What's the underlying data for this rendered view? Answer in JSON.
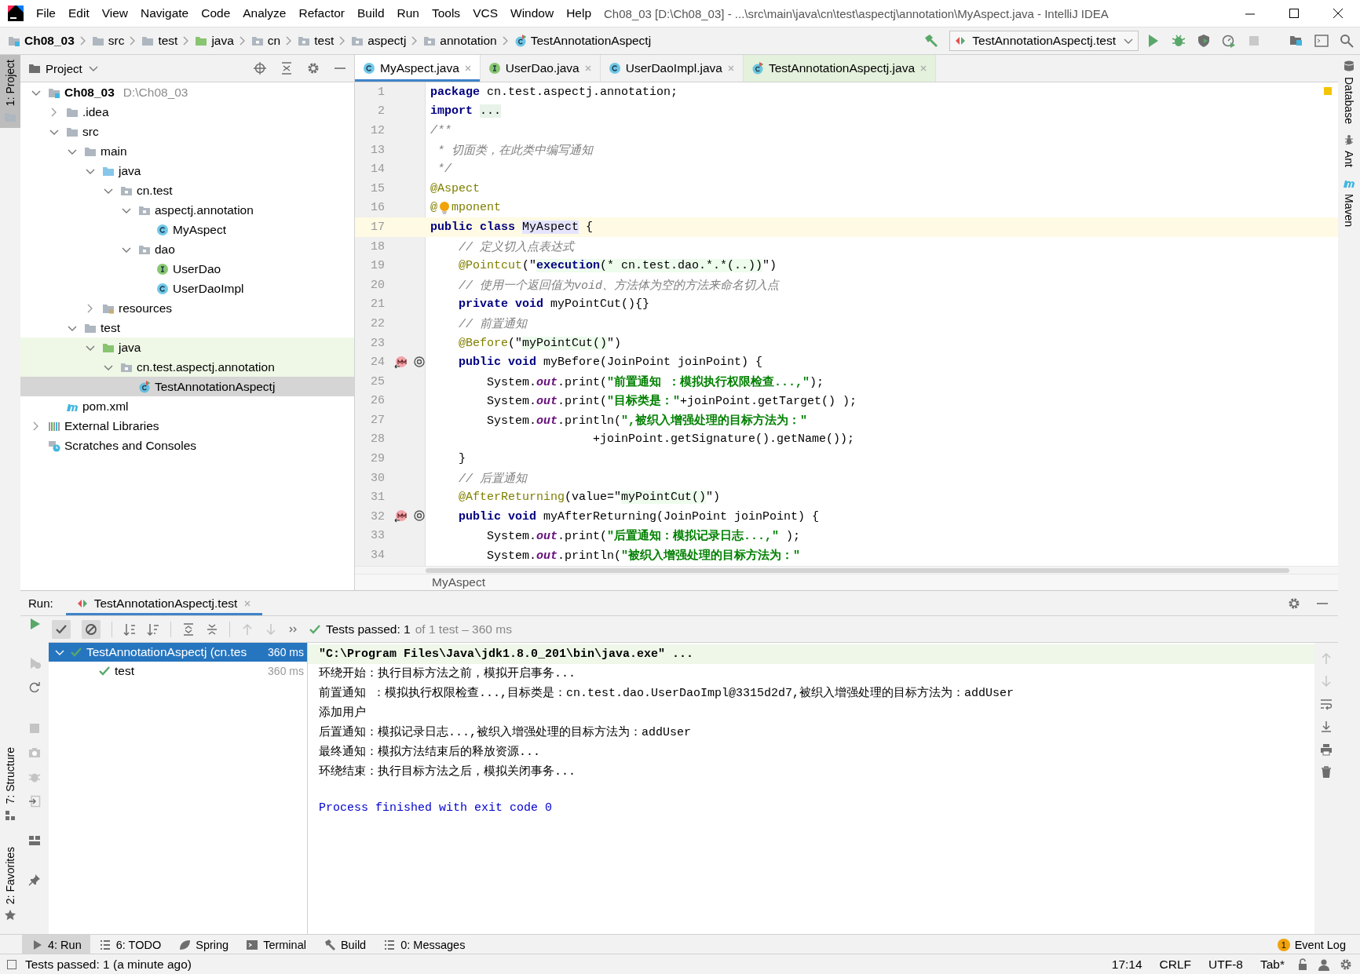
{
  "window": {
    "title": "Ch08_03 [D:\\Ch08_03] - ...\\src\\main\\java\\cn\\test\\aspectj\\annotation\\MyAspect.java - IntelliJ IDEA"
  },
  "menu": [
    "File",
    "Edit",
    "View",
    "Navigate",
    "Code",
    "Analyze",
    "Refactor",
    "Build",
    "Run",
    "Tools",
    "VCS",
    "Window",
    "Help"
  ],
  "navigation_bar": {
    "breadcrumbs": [
      {
        "label": "Ch08_03",
        "kind": "module"
      },
      {
        "label": "src",
        "kind": "folder"
      },
      {
        "label": "test",
        "kind": "folder"
      },
      {
        "label": "java",
        "kind": "test-folder"
      },
      {
        "label": "cn",
        "kind": "package"
      },
      {
        "label": "test",
        "kind": "package"
      },
      {
        "label": "aspectj",
        "kind": "package"
      },
      {
        "label": "annotation",
        "kind": "package"
      },
      {
        "label": "TestAnnotationAspectj",
        "kind": "test-class"
      }
    ],
    "run_configuration": "TestAnnotationAspectj.test"
  },
  "left_tool_stripe": [
    {
      "label": "1: Project",
      "kind": "folder",
      "selected": true
    },
    {
      "label": "7: Structure",
      "kind": "structure",
      "selected": false
    },
    {
      "label": "2: Favorites",
      "kind": "star",
      "selected": false
    }
  ],
  "right_tool_stripe": [
    {
      "label": "Database",
      "kind": "database"
    },
    {
      "label": "Ant",
      "kind": "ant"
    },
    {
      "label": "Maven",
      "kind": "maven"
    }
  ],
  "project_panel": {
    "title": "Project",
    "tree": [
      {
        "label": "Ch08_03",
        "path": "D:\\Ch08_03",
        "kind": "module",
        "expanded": true,
        "selected": false,
        "highlighted": false,
        "children": [
          {
            "label": ".idea",
            "kind": "folder",
            "expanded": false,
            "selected": false,
            "highlighted": false
          },
          {
            "label": "src",
            "kind": "folder",
            "expanded": true,
            "selected": false,
            "highlighted": false,
            "children": [
              {
                "label": "main",
                "kind": "folder",
                "expanded": true,
                "selected": false,
                "highlighted": false,
                "children": [
                  {
                    "label": "java",
                    "kind": "source-folder",
                    "expanded": true,
                    "selected": false,
                    "highlighted": false,
                    "children": [
                      {
                        "label": "cn.test",
                        "kind": "package",
                        "expanded": true,
                        "selected": false,
                        "highlighted": false,
                        "children": [
                          {
                            "label": "aspectj.annotation",
                            "kind": "package",
                            "expanded": true,
                            "selected": false,
                            "highlighted": false,
                            "children": [
                              {
                                "label": "MyAspect",
                                "kind": "class",
                                "selected": false,
                                "highlighted": false
                              }
                            ]
                          },
                          {
                            "label": "dao",
                            "kind": "package",
                            "expanded": true,
                            "selected": false,
                            "highlighted": false,
                            "children": [
                              {
                                "label": "UserDao",
                                "kind": "interface",
                                "selected": false,
                                "highlighted": false
                              },
                              {
                                "label": "UserDaoImpl",
                                "kind": "class",
                                "selected": false,
                                "highlighted": false
                              }
                            ]
                          }
                        ]
                      }
                    ]
                  },
                  {
                    "label": "resources",
                    "kind": "resources",
                    "expanded": false,
                    "selected": false,
                    "highlighted": false
                  }
                ]
              },
              {
                "label": "test",
                "kind": "folder",
                "expanded": true,
                "selected": false,
                "highlighted": false,
                "children": [
                  {
                    "label": "java",
                    "kind": "test-folder",
                    "expanded": true,
                    "selected": false,
                    "highlighted": true,
                    "children": [
                      {
                        "label": "cn.test.aspectj.annotation",
                        "kind": "package",
                        "expanded": true,
                        "selected": false,
                        "highlighted": true,
                        "children": [
                          {
                            "label": "TestAnnotationAspectj",
                            "kind": "test-class",
                            "selected": true,
                            "highlighted": false
                          }
                        ]
                      }
                    ]
                  }
                ]
              }
            ]
          },
          {
            "label": "pom.xml",
            "kind": "maven",
            "selected": false,
            "highlighted": false
          }
        ]
      },
      {
        "label": "External Libraries",
        "kind": "libraries",
        "expanded": false,
        "selected": false,
        "highlighted": false
      },
      {
        "label": "Scratches and Consoles",
        "kind": "scratches",
        "selected": false,
        "highlighted": false
      }
    ]
  },
  "editor": {
    "tabs": [
      {
        "label": "MyAspect.java",
        "kind": "class",
        "selected": true,
        "highlighted": false
      },
      {
        "label": "UserDao.java",
        "kind": "interface",
        "selected": false,
        "highlighted": false
      },
      {
        "label": "UserDaoImpl.java",
        "kind": "class",
        "selected": false,
        "highlighted": false
      },
      {
        "label": "TestAnnotationAspectj.java",
        "kind": "test-class",
        "selected": false,
        "highlighted": true
      }
    ],
    "lines": [
      {
        "number": "1",
        "current": false,
        "advice": false,
        "tokens": [
          {
            "kind": "keyword",
            "text": "package"
          },
          {
            "kind": "plain",
            "text": " cn.test.aspectj.annotation;"
          }
        ]
      },
      {
        "number": "2",
        "current": false,
        "advice": false,
        "tokens": [
          {
            "kind": "keyword",
            "text": "import "
          },
          {
            "kind": "folded",
            "text": "..."
          }
        ]
      },
      {
        "number": "12",
        "current": false,
        "advice": false,
        "tokens": [
          {
            "kind": "comment",
            "text": "/**"
          }
        ]
      },
      {
        "number": "13",
        "current": false,
        "advice": false,
        "tokens": [
          {
            "kind": "comment",
            "text": " * 切面类，在此类中编写通知"
          }
        ]
      },
      {
        "number": "14",
        "current": false,
        "advice": false,
        "tokens": [
          {
            "kind": "comment",
            "text": " */"
          }
        ]
      },
      {
        "number": "15",
        "current": false,
        "advice": false,
        "tokens": [
          {
            "kind": "annotation",
            "text": "@Aspect"
          }
        ]
      },
      {
        "number": "16",
        "current": false,
        "advice": false,
        "tokens": [
          {
            "kind": "annotation",
            "text": "@"
          },
          {
            "kind": "intention"
          },
          {
            "kind": "annotation",
            "text": "mponent"
          }
        ]
      },
      {
        "number": "17",
        "current": true,
        "advice": false,
        "tokens": [
          {
            "kind": "keyword",
            "text": "public class "
          },
          {
            "kind": "declaration",
            "text": "MyAspect"
          },
          {
            "kind": "plain",
            "text": " {"
          }
        ]
      },
      {
        "number": "18",
        "current": false,
        "advice": false,
        "tokens": [
          {
            "kind": "comment",
            "text": "    // 定义切入点表达式"
          }
        ]
      },
      {
        "number": "19",
        "current": false,
        "advice": false,
        "tokens": [
          {
            "kind": "annotation",
            "text": "    @Pointcut"
          },
          {
            "kind": "plain",
            "text": "(\""
          },
          {
            "kind": "injected-keyword",
            "text": "execution"
          },
          {
            "kind": "injected",
            "text": "(* cn.test.dao.*.*(..))"
          },
          {
            "kind": "plain",
            "text": "\")"
          }
        ]
      },
      {
        "number": "20",
        "current": false,
        "advice": false,
        "tokens": [
          {
            "kind": "comment",
            "text": "    // 使用一个返回值为void、方法体为空的方法来命名切入点"
          }
        ]
      },
      {
        "number": "21",
        "current": false,
        "advice": false,
        "tokens": [
          {
            "kind": "keyword",
            "text": "    private void"
          },
          {
            "kind": "plain",
            "text": " myPointCut(){}"
          }
        ]
      },
      {
        "number": "22",
        "current": false,
        "advice": false,
        "tokens": [
          {
            "kind": "comment",
            "text": "    // 前置通知"
          }
        ]
      },
      {
        "number": "23",
        "current": false,
        "advice": false,
        "tokens": [
          {
            "kind": "annotation",
            "text": "    @Before"
          },
          {
            "kind": "plain",
            "text": "(\""
          },
          {
            "kind": "injected",
            "text": "myPointCut()"
          },
          {
            "kind": "plain",
            "text": "\")"
          }
        ]
      },
      {
        "number": "24",
        "current": false,
        "advice": true,
        "tokens": [
          {
            "kind": "keyword",
            "text": "    public void"
          },
          {
            "kind": "plain",
            "text": " myBefore(JoinPoint joinPoint) {"
          }
        ]
      },
      {
        "number": "25",
        "current": false,
        "advice": false,
        "tokens": [
          {
            "kind": "plain",
            "text": "        System."
          },
          {
            "kind": "static",
            "text": "out"
          },
          {
            "kind": "plain",
            "text": ".print("
          },
          {
            "kind": "string",
            "text": "\"前置通知 ：模拟执行权限检查...,\""
          },
          {
            "kind": "plain",
            "text": ");"
          }
        ]
      },
      {
        "number": "26",
        "current": false,
        "advice": false,
        "tokens": [
          {
            "kind": "plain",
            "text": "        System."
          },
          {
            "kind": "static",
            "text": "out"
          },
          {
            "kind": "plain",
            "text": ".print("
          },
          {
            "kind": "string",
            "text": "\"目标类是：\""
          },
          {
            "kind": "plain",
            "text": "+joinPoint.getTarget() );"
          }
        ]
      },
      {
        "number": "27",
        "current": false,
        "advice": false,
        "tokens": [
          {
            "kind": "plain",
            "text": "        System."
          },
          {
            "kind": "static",
            "text": "out"
          },
          {
            "kind": "plain",
            "text": ".println("
          },
          {
            "kind": "string",
            "text": "\",被织入增强处理的目标方法为：\""
          }
        ]
      },
      {
        "number": "28",
        "current": false,
        "advice": false,
        "tokens": [
          {
            "kind": "plain",
            "text": "                       +joinPoint.getSignature().getName());"
          }
        ]
      },
      {
        "number": "29",
        "current": false,
        "advice": false,
        "tokens": [
          {
            "kind": "plain",
            "text": "    }"
          }
        ]
      },
      {
        "number": "30",
        "current": false,
        "advice": false,
        "tokens": [
          {
            "kind": "comment",
            "text": "    // 后置通知"
          }
        ]
      },
      {
        "number": "31",
        "current": false,
        "advice": false,
        "tokens": [
          {
            "kind": "annotation",
            "text": "    @AfterReturning"
          },
          {
            "kind": "plain",
            "text": "(value=\""
          },
          {
            "kind": "injected",
            "text": "myPointCut()"
          },
          {
            "kind": "plain",
            "text": "\")"
          }
        ]
      },
      {
        "number": "32",
        "current": false,
        "advice": true,
        "tokens": [
          {
            "kind": "keyword",
            "text": "    public void"
          },
          {
            "kind": "plain",
            "text": " myAfterReturning(JoinPoint joinPoint) {"
          }
        ]
      },
      {
        "number": "33",
        "current": false,
        "advice": false,
        "tokens": [
          {
            "kind": "plain",
            "text": "        System."
          },
          {
            "kind": "static",
            "text": "out"
          },
          {
            "kind": "plain",
            "text": ".print("
          },
          {
            "kind": "string",
            "text": "\"后置通知：模拟记录日志...,\""
          },
          {
            "kind": "plain",
            "text": " );"
          }
        ]
      },
      {
        "number": "34",
        "current": false,
        "advice": false,
        "tokens": [
          {
            "kind": "plain",
            "text": "        System."
          },
          {
            "kind": "static",
            "text": "out"
          },
          {
            "kind": "plain",
            "text": ".println("
          },
          {
            "kind": "string",
            "text": "\"被织入增强处理的目标方法为：\""
          }
        ]
      }
    ],
    "breadcrumb": "MyAspect"
  },
  "run_panel": {
    "label": "Run:",
    "tab": "TestAnnotationAspectj.test",
    "status": "Tests passed: 1",
    "status_detail": "of 1 test – 360 ms",
    "tests": [
      {
        "label": "TestAnnotationAspectj (cn.tes",
        "time": "360 ms",
        "selected": true,
        "expanded": true,
        "children": [
          {
            "label": "test",
            "time": "360 ms",
            "selected": false
          }
        ]
      }
    ],
    "console": [
      {
        "kind": "command",
        "text": "\"C:\\Program Files\\Java\\jdk1.8.0_201\\bin\\java.exe\" ..."
      },
      {
        "kind": "output",
        "text": "环绕开始：执行目标方法之前，模拟开启事务..."
      },
      {
        "kind": "output",
        "text": "前置通知 ：模拟执行权限检查...,目标类是：cn.test.dao.UserDaoImpl@3315d2d7,被织入增强处理的目标方法为：addUser"
      },
      {
        "kind": "output",
        "text": "添加用户"
      },
      {
        "kind": "output",
        "text": "后置通知：模拟记录日志...,被织入增强处理的目标方法为：addUser"
      },
      {
        "kind": "output",
        "text": "最终通知：模拟方法结束后的释放资源..."
      },
      {
        "kind": "output",
        "text": "环绕结束：执行目标方法之后，模拟关闭事务..."
      },
      {
        "kind": "exit",
        "text": "Process finished with exit code 0"
      }
    ]
  },
  "tool_window_bar": [
    {
      "label": "4: Run",
      "kind": "run",
      "selected": true
    },
    {
      "label": "6: TODO",
      "kind": "list",
      "selected": false
    },
    {
      "label": "Spring",
      "kind": "leaf",
      "selected": false
    },
    {
      "label": "Terminal",
      "kind": "terminal",
      "selected": false
    },
    {
      "label": "Build",
      "kind": "hammer",
      "selected": false
    },
    {
      "label": "0: Messages",
      "kind": "list",
      "selected": false
    }
  ],
  "event_log": {
    "label": "Event Log",
    "count": "1"
  },
  "status_bar": {
    "message": "Tests passed: 1 (a minute ago)",
    "items": [
      "17:14",
      "CRLF",
      "UTF-8",
      "Tab*"
    ]
  }
}
